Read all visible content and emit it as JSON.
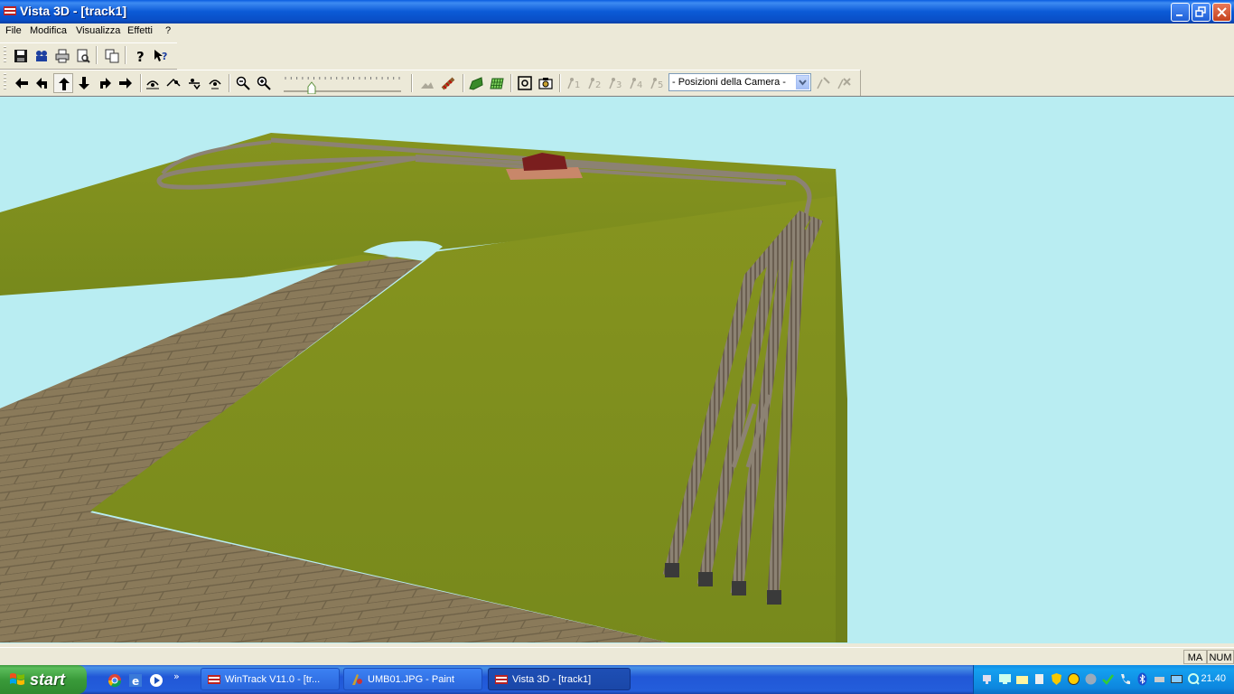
{
  "window": {
    "title": "Vista 3D - [track1]",
    "buttons": [
      "minimize-icon",
      "restore-icon",
      "close-icon"
    ]
  },
  "menu": [
    "File",
    "Modifica",
    "Visualizza",
    "Effetti",
    "?"
  ],
  "toolbar1": {
    "icons": [
      "save-icon",
      "camera-settings-icon",
      "print-icon",
      "print-preview-icon",
      "copy-icon",
      "help-icon",
      "context-help-icon"
    ]
  },
  "toolbar2": {
    "icons": [
      "move-left-icon",
      "rotate-left-icon",
      "move-forward-icon",
      "move-back-icon",
      "rotate-right-icon",
      "move-right-icon",
      "look-up-icon",
      "tilt-up-icon",
      "tilt-down-icon",
      "look-down-icon",
      "zoom-out-icon",
      "zoom-in-icon",
      "terrain-icon",
      "track-icon",
      "landscape-icon",
      "grid-icon",
      "fit-view-icon",
      "snapshot-icon",
      "camera-1-icon",
      "camera-2-icon",
      "camera-3-icon",
      "camera-4-icon",
      "camera-5-icon",
      "add-camera-icon",
      "delete-camera-icon"
    ],
    "speed_slider_value": 0.23,
    "camera_select": "- Posizioni della Camera -"
  },
  "status": {
    "caps": "MA",
    "num": "NUM"
  },
  "taskbar": {
    "start": "start",
    "tasks": [
      {
        "label": "WinTrack  V11.0 - [tr...",
        "active": false
      },
      {
        "label": "UMB01.JPG - Paint",
        "active": false
      },
      {
        "label": "Vista 3D - [track1]",
        "active": true
      }
    ],
    "clock": "21.40"
  },
  "colors": {
    "sky": "#b9edf2",
    "grass": "#7f8f1e",
    "paving": "#8a7a5a",
    "track": "#8c8273"
  }
}
